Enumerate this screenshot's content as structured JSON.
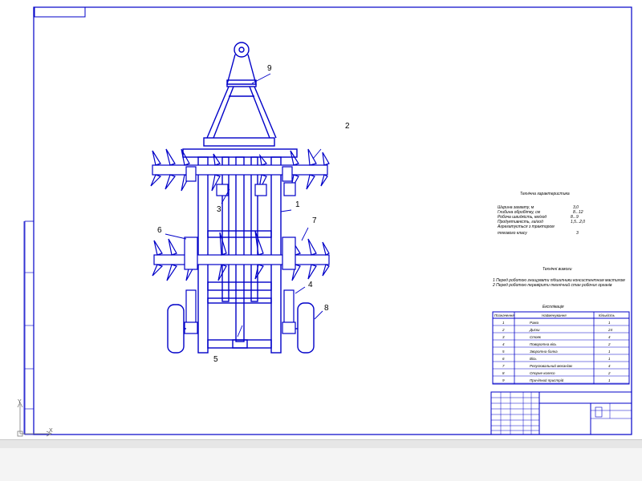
{
  "drawing": {
    "callouts": [
      "1",
      "2",
      "3",
      "4",
      "5",
      "6",
      "7",
      "8",
      "9"
    ],
    "specs_title": "Технічна характеристика",
    "specs": [
      {
        "label": "Ширина захвату, м",
        "value": "3,0"
      },
      {
        "label": "Глибина обробітку, см",
        "value": "8...12"
      },
      {
        "label": "Робоча швидкість, км/год",
        "value": "8...9"
      },
      {
        "label": "Продуктивність,  га/год",
        "value": "1,5...2,0"
      },
      {
        "label": "Агрегатується з трактором",
        "value": ""
      },
      {
        "label": "тягового класу",
        "value": "3"
      }
    ],
    "notes_title": "Технічні вимоги",
    "notes": [
      "1  Перед роботою знищувати підшипники  консистентним мастилом",
      "2  Перед роботою перевірити технічний стан робочих органів"
    ],
    "spec_table": {
      "title": "Експлікація",
      "headers": [
        "Позначення",
        "Найменування",
        "Кількість"
      ],
      "rows": [
        [
          "1",
          "Рама",
          "1"
        ],
        [
          "2",
          "Диски",
          "24"
        ],
        [
          "3",
          "Стояк",
          "4"
        ],
        [
          "4",
          "Поворотна вісь",
          "2"
        ],
        [
          "5",
          "Зворотна балка",
          "1"
        ],
        [
          "6",
          "Вісь",
          "1"
        ],
        [
          "7",
          "Регулювальний механізм",
          "4"
        ],
        [
          "8",
          "Опорне колесо",
          "2"
        ],
        [
          "9",
          "Причіпний пристрій",
          "1"
        ]
      ]
    }
  },
  "axis": {
    "y": "Y",
    "x": "X"
  },
  "colors": {
    "line": "#0000c8",
    "paper": "#ffffff",
    "statusbar": "#e6e6e6"
  }
}
